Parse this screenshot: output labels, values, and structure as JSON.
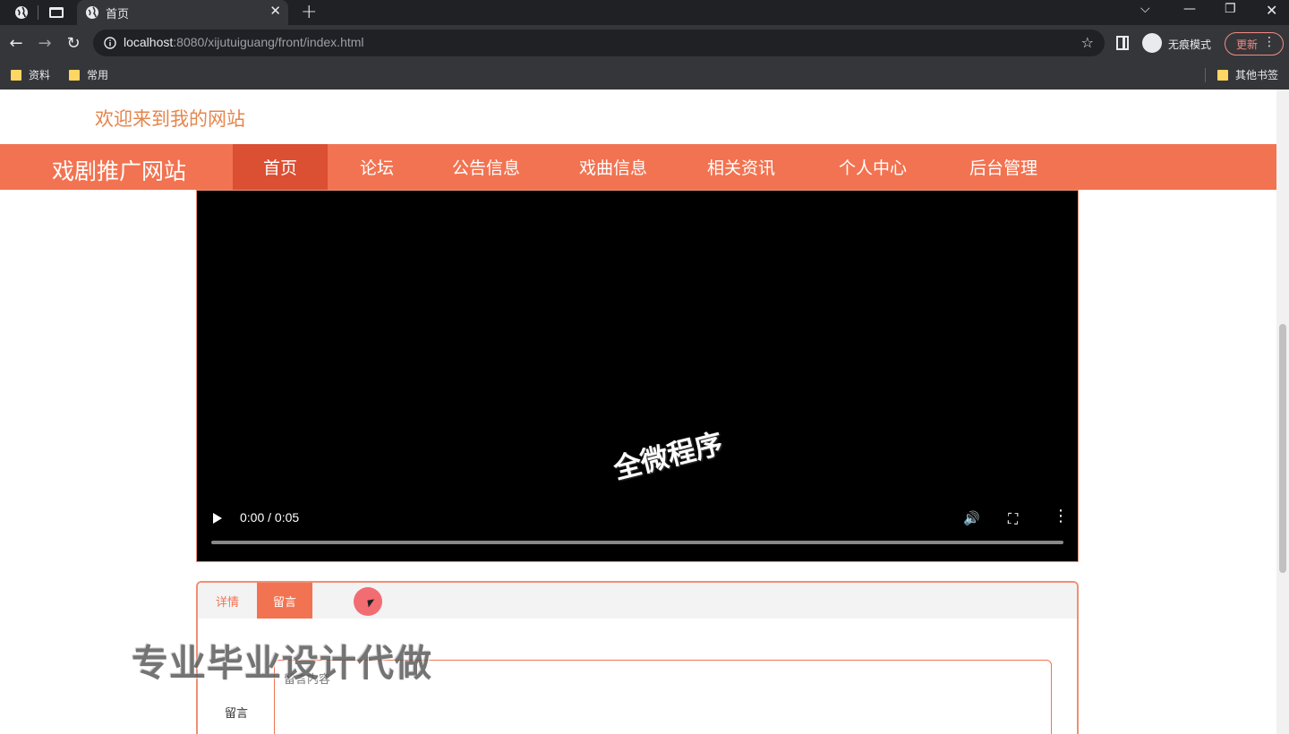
{
  "browser": {
    "tab_title": "首页",
    "url_host": "localhost",
    "url_rest": ":8080/xijutuiguang/front/index.html",
    "incognito_label": "无痕模式",
    "update_label": "更新",
    "bookmarks": [
      "资料",
      "常用"
    ],
    "other_bookmarks": "其他书签"
  },
  "site": {
    "welcome": "欢迎来到我的网站",
    "brand": "戏剧推广网站",
    "nav": [
      {
        "label": "首页",
        "active": true
      },
      {
        "label": "论坛",
        "active": false
      },
      {
        "label": "公告信息",
        "active": false
      },
      {
        "label": "戏曲信息",
        "active": false
      },
      {
        "label": "相关资讯",
        "active": false
      },
      {
        "label": "个人中心",
        "active": false
      },
      {
        "label": "后台管理",
        "active": false
      }
    ]
  },
  "video": {
    "time": "0:00 / 0:05",
    "watermark": "全微程序"
  },
  "detail": {
    "tabs": [
      {
        "label": "详情",
        "active": false
      },
      {
        "label": "留言",
        "active": true
      }
    ],
    "field_label": "留言",
    "placeholder": "留言内容"
  },
  "overlay_watermark": "专业毕业设计代做",
  "colors": {
    "accent": "#f27351",
    "accent_active": "#db4f33",
    "welcome_text": "#e6854c"
  }
}
